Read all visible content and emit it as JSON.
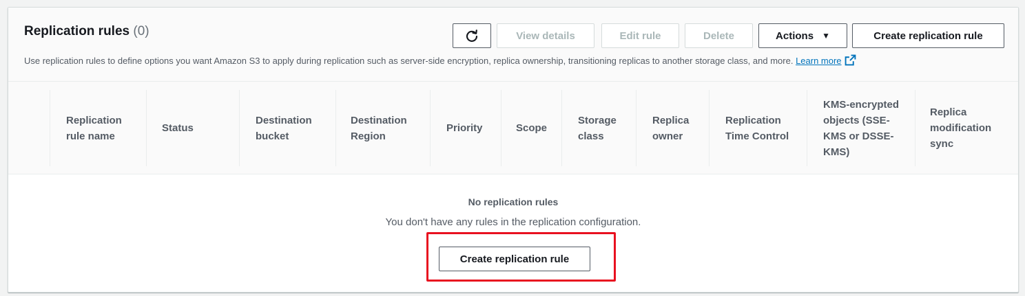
{
  "header": {
    "title": "Replication rules",
    "count": "(0)",
    "description": "Use replication rules to define options you want Amazon S3 to apply during replication such as server-side encryption, replica ownership, transitioning replicas to another storage class, and more.",
    "learn_more": "Learn more"
  },
  "toolbar": {
    "refresh_icon": "refresh-icon",
    "view_details": "View details",
    "edit_rule": "Edit rule",
    "delete": "Delete",
    "actions": "Actions",
    "actions_caret": "▼",
    "create_rule": "Create replication rule"
  },
  "table": {
    "columns": [
      "Replication rule name",
      "Status",
      "Destination bucket",
      "Destination Region",
      "Priority",
      "Scope",
      "Storage class",
      "Replica owner",
      "Replication Time Control",
      "KMS-encrypted objects (SSE-KMS or DSSE-KMS)",
      "Replica modification sync"
    ]
  },
  "empty_state": {
    "title": "No replication rules",
    "message": "You don't have any rules in the replication configuration.",
    "button": "Create replication rule"
  },
  "colors": {
    "highlight": "#e8101f",
    "link": "#0073bb"
  }
}
